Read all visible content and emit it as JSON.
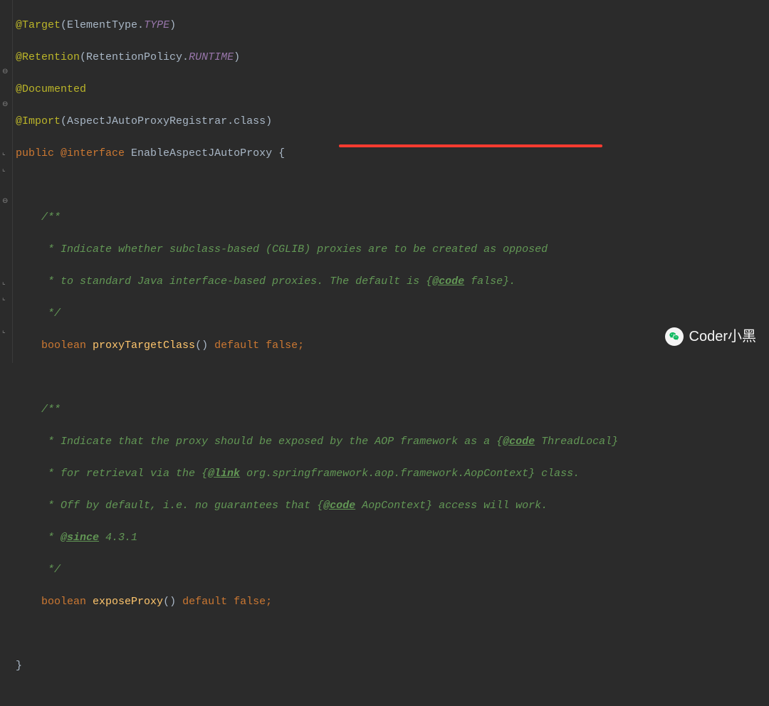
{
  "annotations": {
    "target": {
      "name": "@Target",
      "argPrefix": "ElementType.",
      "argConst": "TYPE"
    },
    "retention": {
      "name": "@Retention",
      "argPrefix": "RetentionPolicy.",
      "argConst": "RUNTIME"
    },
    "documented": {
      "name": "@Documented"
    },
    "import": {
      "name": "@Import",
      "arg": "AspectJAutoProxyRegistrar.class"
    }
  },
  "declaration": {
    "modifiers": "public ",
    "atInterface": "@interface ",
    "name": "EnableAspectJAutoProxy",
    "openBrace": " {"
  },
  "member1": {
    "doc": {
      "open": "    /**",
      "l1": "     * Indicate whether subclass-based (CGLIB) proxies are to be created as opposed",
      "l2a": "     * to standard Java interface-based proxies. The default is {",
      "l2tag": "@code",
      "l2b": " false}.",
      "close": "     */"
    },
    "sig": {
      "indent": "    ",
      "retType": "boolean ",
      "name": "proxyTargetClass",
      "parens": "()",
      "defaultKw": " default ",
      "defaultVal": "false",
      "semi": ";"
    }
  },
  "member2": {
    "doc": {
      "open": "    /**",
      "l1a": "     * Indicate that the proxy should be exposed by the AOP framework as a {",
      "l1tag": "@code",
      "l1b": " ThreadLocal}",
      "l2a": "     * for retrieval via the {",
      "l2tag": "@link",
      "l2b": " org.springframework.aop.framework.AopContext} class.",
      "l3a": "     * Off by default, i.e. no guarantees that {",
      "l3tag": "@code",
      "l3b": " AopContext} access will work.",
      "l4a": "     * ",
      "l4tag": "@since",
      "l4b": " 4.3.1",
      "close": "     */"
    },
    "sig": {
      "indent": "    ",
      "retType": "boolean ",
      "name": "exposeProxy",
      "parens": "()",
      "defaultKw": " default ",
      "defaultVal": "false",
      "semi": ";"
    }
  },
  "closeBrace": "}",
  "watermark": {
    "text": "Coder小黑"
  }
}
